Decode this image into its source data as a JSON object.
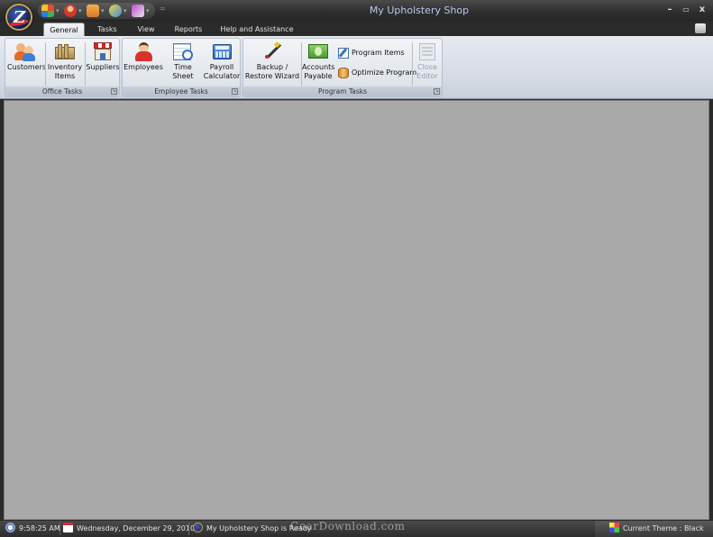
{
  "window": {
    "title": "My Upholstery Shop",
    "minimize": "–",
    "restore": "▭",
    "close": "x"
  },
  "quick_access": {
    "more": "="
  },
  "tabs": [
    {
      "label": "General",
      "active": true
    },
    {
      "label": "Tasks",
      "active": false
    },
    {
      "label": "View",
      "active": false
    },
    {
      "label": "Reports",
      "active": false
    },
    {
      "label": "Help and Assistance",
      "active": false
    }
  ],
  "ribbon": {
    "office_tasks": {
      "label": "Office Tasks",
      "buttons": [
        {
          "label": "Customers",
          "icon": "customers-icon"
        },
        {
          "label": "Inventory Items",
          "icon": "inventory-icon"
        },
        {
          "label": "Suppliers",
          "icon": "suppliers-icon"
        }
      ]
    },
    "employee_tasks": {
      "label": "Employee Tasks",
      "buttons": [
        {
          "label": "Employees",
          "icon": "employee-icon"
        },
        {
          "label": "Time Sheet",
          "icon": "timesheet-icon"
        },
        {
          "label": "Payroll Calculator",
          "icon": "calculator-icon"
        }
      ]
    },
    "program_tasks": {
      "label": "Program Tasks",
      "buttons": [
        {
          "label": "Backup / Restore Wizard",
          "icon": "wand-icon"
        },
        {
          "label": "Accounts Payable",
          "icon": "money-icon"
        },
        {
          "label": "Program Items",
          "icon": "edit-icon"
        },
        {
          "label": "Optimize Program",
          "icon": "database-icon"
        },
        {
          "label": "Close Editor",
          "icon": "close-editor-icon",
          "disabled": true
        }
      ]
    }
  },
  "status": {
    "time": "9:58:25 AM",
    "date": "Wednesday, December 29, 2010",
    "message": "My Upholstery Shop is Ready",
    "theme": "Current Theme : Black",
    "watermark": "GearDownload.com"
  },
  "colors": {
    "chrome": "#2b2b2b",
    "ribbon": "#dfe4eb",
    "workspace": "#a9a9a9",
    "title_text": "#b8c8e8"
  }
}
